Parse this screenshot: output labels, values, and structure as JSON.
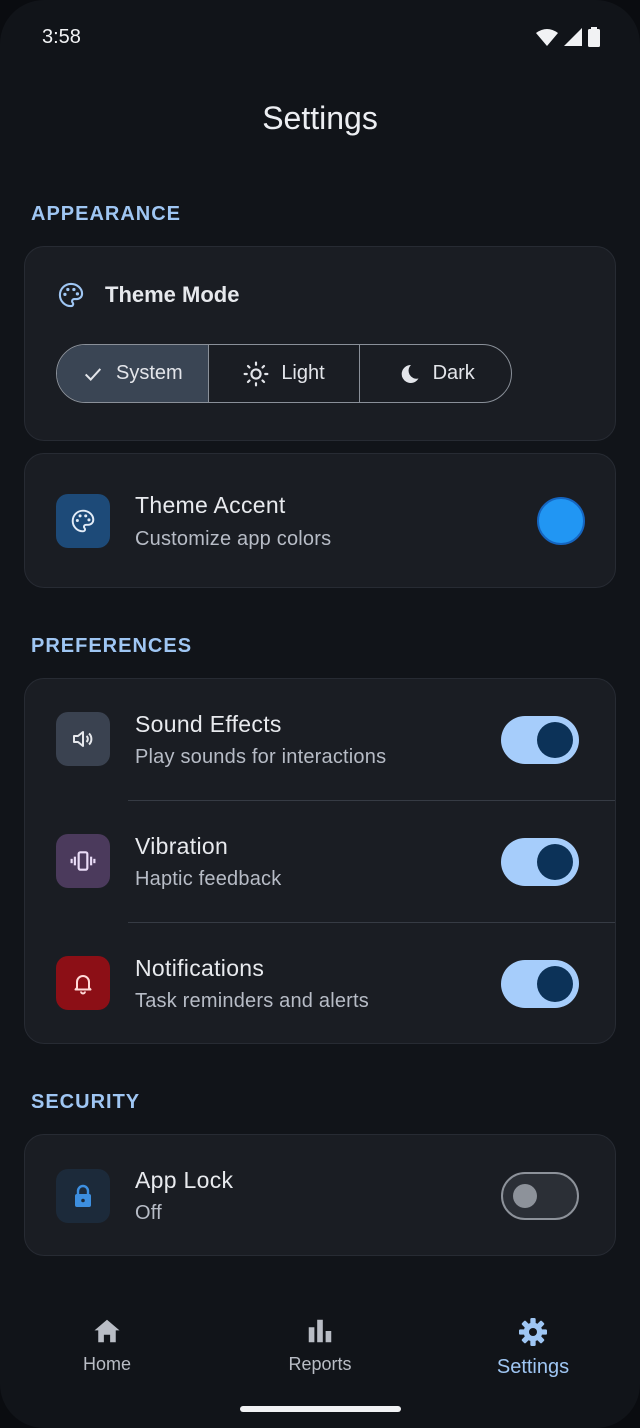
{
  "status_bar": {
    "time": "3:58"
  },
  "page": {
    "title": "Settings"
  },
  "appearance": {
    "section_label": "APPEARANCE",
    "theme_mode": {
      "title": "Theme Mode",
      "options": [
        "System",
        "Light",
        "Dark"
      ],
      "selected": "System"
    },
    "theme_accent": {
      "title": "Theme Accent",
      "subtitle": "Customize app colors",
      "accent_color": "#2196f3"
    }
  },
  "preferences": {
    "section_label": "PREFERENCES",
    "items": [
      {
        "title": "Sound Effects",
        "subtitle": "Play sounds for interactions",
        "enabled": true,
        "icon": "volume-icon",
        "icon_bg": "#3a4250",
        "icon_color": "#e6e8ec"
      },
      {
        "title": "Vibration",
        "subtitle": "Haptic feedback",
        "enabled": true,
        "icon": "vibration-icon",
        "icon_bg": "#4b3a5c",
        "icon_color": "#eadcf7"
      },
      {
        "title": "Notifications",
        "subtitle": "Task reminders and alerts",
        "enabled": true,
        "icon": "bell-icon",
        "icon_bg": "#8c0f16",
        "icon_color": "#ffdad8"
      }
    ]
  },
  "security": {
    "section_label": "SECURITY",
    "app_lock": {
      "title": "App Lock",
      "subtitle": "Off",
      "enabled": false,
      "icon": "lock-icon",
      "icon_bg": "#1c2a3a",
      "icon_color": "#3d8fe0"
    }
  },
  "bottom_nav": {
    "items": [
      {
        "label": "Home",
        "icon": "home-icon"
      },
      {
        "label": "Reports",
        "icon": "bar-chart-icon"
      },
      {
        "label": "Settings",
        "icon": "gear-icon"
      }
    ],
    "active": "Settings"
  },
  "colors": {
    "accent": "#9fc6f3",
    "background": "#111419",
    "card": "#1a1d23",
    "toggle_on_track": "#a6cdfb",
    "toggle_on_knob": "#0c3258"
  }
}
